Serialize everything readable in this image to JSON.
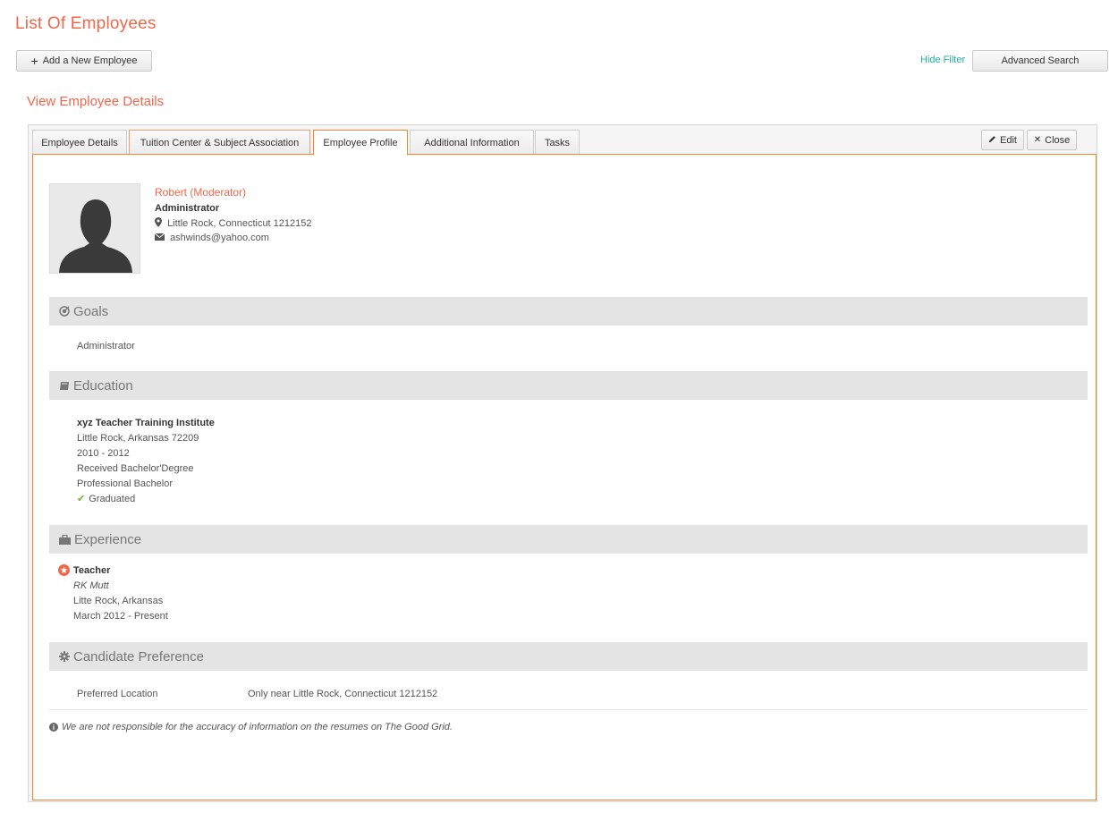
{
  "page": {
    "title": "List Of Employees"
  },
  "toolbar": {
    "add_label": "Add a New Employee",
    "hide_filter_label": "Hide Filter",
    "advanced_search_label": "Advanced Search"
  },
  "section": {
    "title": "View Employee Details"
  },
  "tabs": [
    {
      "label": "Employee Details",
      "active": false
    },
    {
      "label": "Tuition Center & Subject Association",
      "active": false
    },
    {
      "label": "Employee Profile",
      "active": true
    },
    {
      "label": "Additional Information",
      "active": false
    },
    {
      "label": "Tasks",
      "active": false
    }
  ],
  "actions": {
    "edit_label": "Edit",
    "close_label": "Close"
  },
  "profile": {
    "name": "Robert (Moderator)",
    "role": "Administrator",
    "location": "Little Rock, Connecticut  1212152",
    "email": "ashwinds@yahoo.com"
  },
  "goals": {
    "heading": "Goals",
    "text": "Administrator"
  },
  "education": {
    "heading": "Education",
    "institute": "xyz Teacher Training Institute",
    "location": "Little Rock, Arkansas  72209",
    "years": "2010 - 2012",
    "degree": "Received Bachelor'Degree",
    "program": "Professional Bachelor",
    "status": "Graduated"
  },
  "experience": {
    "heading": "Experience",
    "title": "Teacher",
    "company": "RK Mutt",
    "location": "Litte Rock, Arkansas",
    "period": "March 2012 - Present"
  },
  "candidate_preference": {
    "heading": "Candidate Preference",
    "label": "Preferred Location",
    "value": "Only near Little Rock, Connecticut 1212152"
  },
  "disclaimer": "We are not responsible for the accuracy of information on the resumes on The Good Grid.",
  "colors": {
    "accent": "#f0674a",
    "tab_active_border": "#f0872c",
    "link_teal": "#20b1a0",
    "check_green": "#6fb53a",
    "section_bar": "#e4e4e4"
  }
}
